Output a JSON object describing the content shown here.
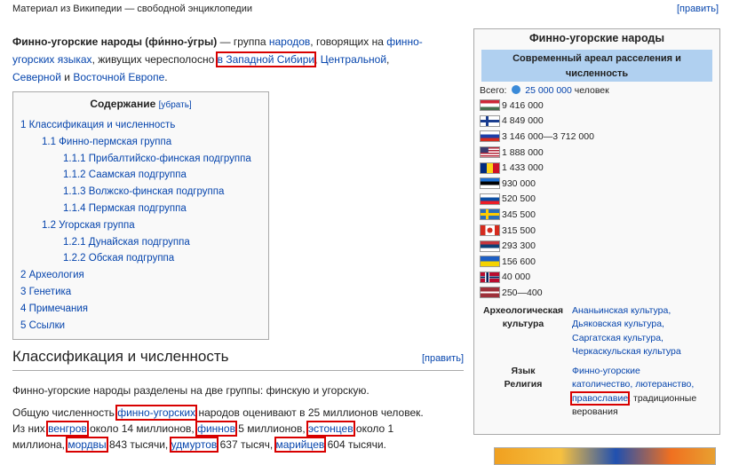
{
  "top": {
    "from": "Материал из Википедии — свободной энциклопедии",
    "edit": "[править]"
  },
  "intro": {
    "title_bold": "Финно-угорские народы (фи́нно-у́гры)",
    "t1": " — группа ",
    "l_peoples": "народов",
    "t2": ", говорящих на ",
    "l_lang": "финно-угорских языках",
    "t3": ", живущих чересполосно ",
    "l_west": "в Западной Сибири",
    "t4": ", ",
    "l_central": "Центральной",
    "t5": ", ",
    "l_north": "Северной",
    "t6": " и ",
    "l_east": "Восточной Европе",
    "t7": "."
  },
  "toc": {
    "title": "Содержание",
    "toggle": "[убрать]",
    "items": [
      {
        "level": 1,
        "label": "1 Классификация и численность"
      },
      {
        "level": 2,
        "label": "1.1 Финно-пермская группа"
      },
      {
        "level": 3,
        "label": "1.1.1 Прибалтийско-финская подгруппа"
      },
      {
        "level": 3,
        "label": "1.1.2 Саамская подгруппа"
      },
      {
        "level": 3,
        "label": "1.1.3 Волжско-финская подгруппа"
      },
      {
        "level": 3,
        "label": "1.1.4 Пермская подгруппа"
      },
      {
        "level": 2,
        "label": "1.2 Угорская группа"
      },
      {
        "level": 3,
        "label": "1.2.1 Дунайская подгруппа"
      },
      {
        "level": 3,
        "label": "1.2.2 Обская подгруппа"
      },
      {
        "level": 1,
        "label": "2 Археология"
      },
      {
        "level": 1,
        "label": "3 Генетика"
      },
      {
        "level": 1,
        "label": "4 Примечания"
      },
      {
        "level": 1,
        "label": "5 Ссылки"
      }
    ]
  },
  "section": {
    "title": "Классификация и численность",
    "edit": "[править]"
  },
  "p1": "Финно-угорские народы разделены на две группы: финскую и угорскую.",
  "p2": {
    "a": "Общую численность ",
    "l1": "финно-угорских",
    "b": " народов оценивают в 25 миллионов человек.",
    "c": "Из них ",
    "l2": "венгров",
    "d": " около 14 миллионов, ",
    "l3": "финнов",
    "e": " 5 миллионов, ",
    "l4": "эстонцев",
    "f": " около 1",
    "g": "миллиона, ",
    "l5": "мордвы",
    "h": " 843 тысячи, ",
    "l6": "удмуртов",
    "i": " 637 тысяч, ",
    "l7": "марийцев",
    "j": " 604 тысячи."
  },
  "infobox": {
    "title": "Финно-угорские народы",
    "header": "Современный ареал расселения и численность",
    "total_label": "Всего:",
    "total_value": "25 000 000",
    "total_unit": "человек",
    "rows": [
      {
        "flag": "hungary",
        "value": "9 416 000"
      },
      {
        "flag": "finland",
        "value": "4 849 000"
      },
      {
        "flag": "russia",
        "value": "3 146 000—3 712 000"
      },
      {
        "flag": "usa",
        "value": "1 888 000"
      },
      {
        "flag": "romania",
        "value": "1 433 000"
      },
      {
        "flag": "estonia",
        "value": "930 000"
      },
      {
        "flag": "slovakia",
        "value": "520 500"
      },
      {
        "flag": "sweden",
        "value": "345 500"
      },
      {
        "flag": "canada",
        "value": "315 500"
      },
      {
        "flag": "serbia",
        "value": "293 300"
      },
      {
        "flag": "ukraine",
        "value": "156 600"
      },
      {
        "flag": "norway",
        "value": "40 000"
      },
      {
        "flag": "latvia",
        "value": "250—400"
      }
    ],
    "arch_label": "Археологическая культура",
    "arch_values": [
      "Ананьинская культура,",
      "Дьяковская культура,",
      "Саргатская культура,",
      "Черкаскульская культура"
    ],
    "lang_label": "Язык",
    "lang_value": "Финно-угорские",
    "rel_label": "Религия",
    "rel_l1": "католичество, лютеранство,",
    "rel_l2": "православие",
    "rel_t": ", традиционные верования"
  }
}
